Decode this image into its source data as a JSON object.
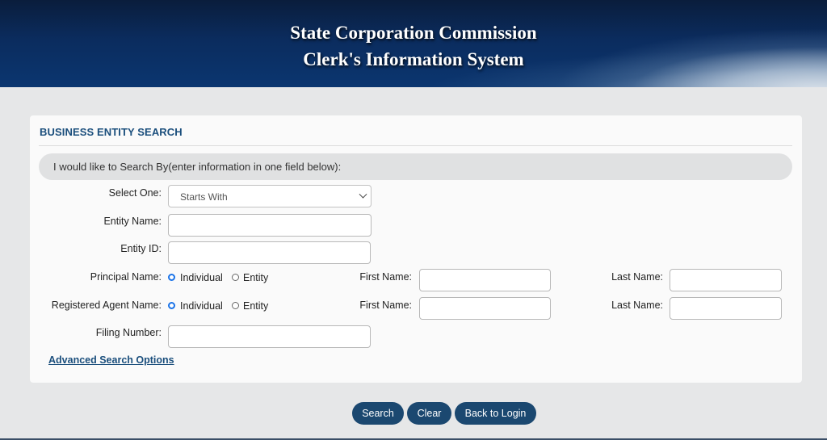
{
  "header": {
    "line1": "State Corporation Commission",
    "line2": "Clerk's Information System"
  },
  "panel": {
    "title": "BUSINESS ENTITY SEARCH",
    "search_by": "I would like to Search By(enter information in one field below):"
  },
  "form": {
    "select_one_label": "Select One:",
    "select_one_value": "Starts With",
    "entity_name_label": "Entity Name:",
    "entity_id_label": "Entity ID:",
    "principal_name_label": "Principal Name:",
    "registered_agent_label": "Registered Agent Name:",
    "filing_number_label": "Filing Number:",
    "individual_label": "Individual",
    "entity_label": "Entity",
    "first_name_label": "First Name:",
    "last_name_label": "Last Name:",
    "advanced_link": "Advanced Search Options"
  },
  "buttons": {
    "search": "Search",
    "clear": "Clear",
    "back": "Back to Login"
  },
  "colors": {
    "accent": "#1a4e7c",
    "button": "#1b4870",
    "radio_selected": "#1a73e8"
  }
}
